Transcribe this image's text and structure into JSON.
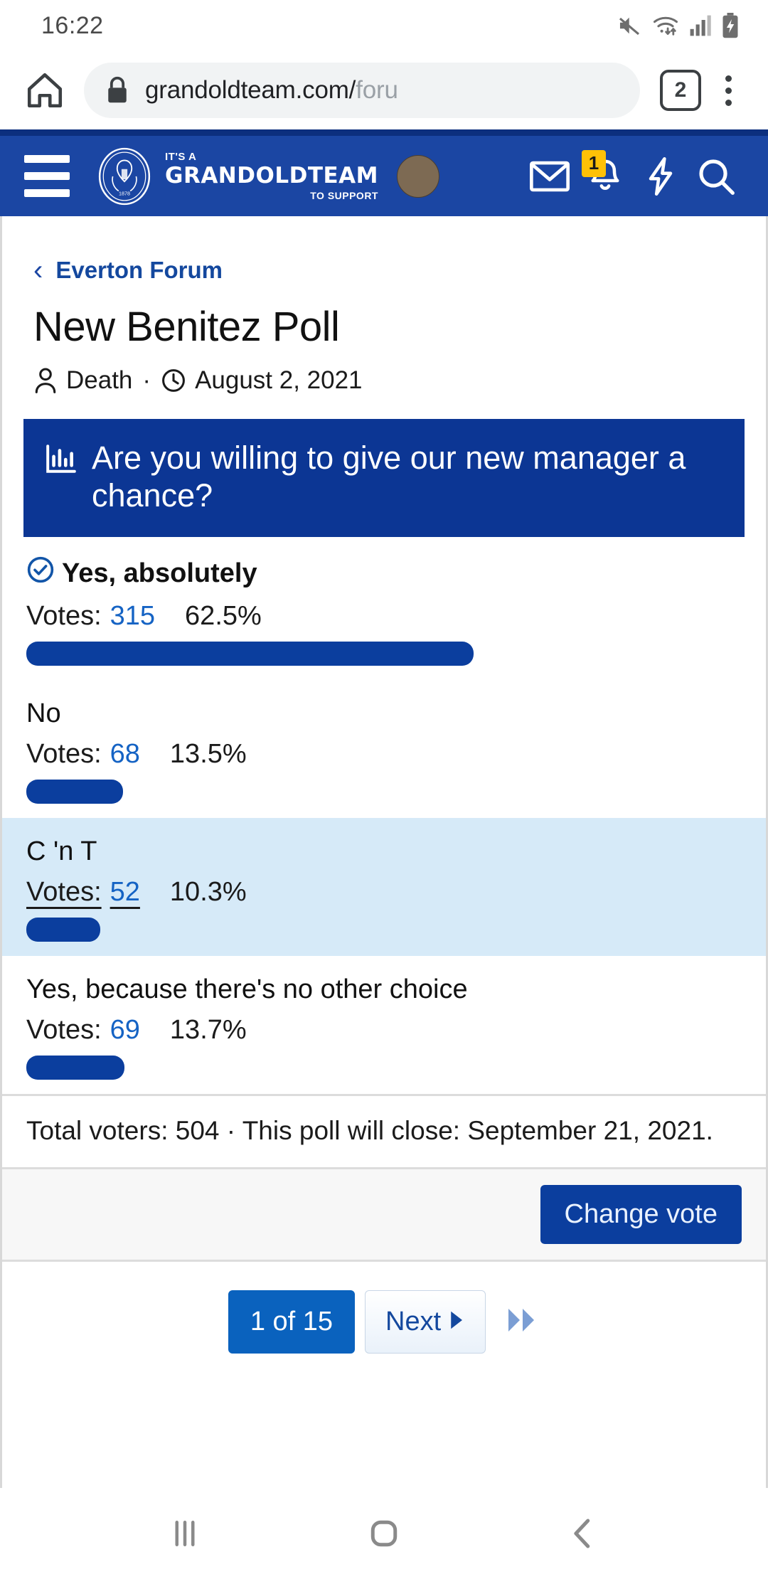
{
  "status_bar": {
    "time": "16:22",
    "icons": [
      "mute-icon",
      "wifi-icon",
      "signal-icon",
      "battery-charging-icon"
    ]
  },
  "browser": {
    "home_icon": "home-icon",
    "lock_icon": "lock-icon",
    "url_visible": "grandoldteam.com/",
    "url_dim": "foru",
    "tab_count": "2",
    "menu_icon": "overflow-menu-icon"
  },
  "site_nav": {
    "menu_icon": "hamburger-menu-icon",
    "crest_icon": "everton-crest-icon",
    "brand_line1": "IT'S A",
    "brand_line2": "GRANDOLDTEAM",
    "brand_line3": "TO SUPPORT",
    "avatar": "user-avatar",
    "mail_icon": "mail-icon",
    "bell_icon": "bell-icon",
    "bell_badge": "1",
    "bolt_icon": "lightning-bolt-icon",
    "search_icon": "search-icon",
    "bg_color": "#1b46a3",
    "badge_color": "#ffc107"
  },
  "thread": {
    "breadcrumb": "Everton Forum",
    "back_icon": "chevron-left-icon",
    "title": "New Benitez Poll",
    "author_icon": "user-icon",
    "author": "Death",
    "separator": "·",
    "date_icon": "clock-icon",
    "date": "August 2, 2021"
  },
  "poll": {
    "chart_icon": "poll-bars-icon",
    "question": "Are you willing to give our new manager a chance?",
    "header_color": "#0c3694",
    "votes_label": "Votes:",
    "total_text": "Total voters: 504 · This poll will close: September 21, 2021.",
    "change_vote_label": "Change vote",
    "voted_icon": "check-circle-icon"
  },
  "pagination": {
    "current_label": "1 of 15",
    "next_label": "Next",
    "next_icon": "triangle-right-icon",
    "last_icon": "double-chevron-right-icon"
  },
  "android_nav": {
    "recents_icon": "recents-icon",
    "home_icon": "home-square-icon",
    "back_icon": "back-chevron-icon"
  },
  "chart_data": {
    "type": "bar",
    "title": "Are you willing to give our new manager a chance?",
    "categories": [
      "Yes, absolutely",
      "No",
      "C 'n T",
      "Yes, because there's no other choice"
    ],
    "values": [
      315,
      68,
      52,
      69
    ],
    "percentages": [
      "62.5%",
      "13.5%",
      "10.3%",
      "13.7%"
    ],
    "percent_values": [
      62.5,
      13.5,
      10.3,
      13.7
    ],
    "bar_widths_pct": [
      62.5,
      13.5,
      10.3,
      13.7
    ],
    "total_voters": 504,
    "voted_index": 0,
    "highlighted_index": 2,
    "underlined_index": 2,
    "bar_color": "#0b3e9e",
    "highlight_color": "#d6eaf8",
    "xlabel": "",
    "ylabel": "Votes",
    "legend": []
  },
  "options": [
    {
      "label": "Yes, absolutely",
      "votes": "315",
      "pct": "62.5%",
      "width": "62.5%",
      "voted": true,
      "highlight": false,
      "underlined": false
    },
    {
      "label": "No",
      "votes": "68",
      "pct": "13.5%",
      "width": "13.5%",
      "voted": false,
      "highlight": false,
      "underlined": false
    },
    {
      "label": "C 'n T",
      "votes": "52",
      "pct": "10.3%",
      "width": "10.3%",
      "voted": false,
      "highlight": true,
      "underlined": true
    },
    {
      "label": "Yes, because there's no other choice",
      "votes": "69",
      "pct": "13.7%",
      "width": "13.7%",
      "voted": false,
      "highlight": false,
      "underlined": false
    }
  ]
}
